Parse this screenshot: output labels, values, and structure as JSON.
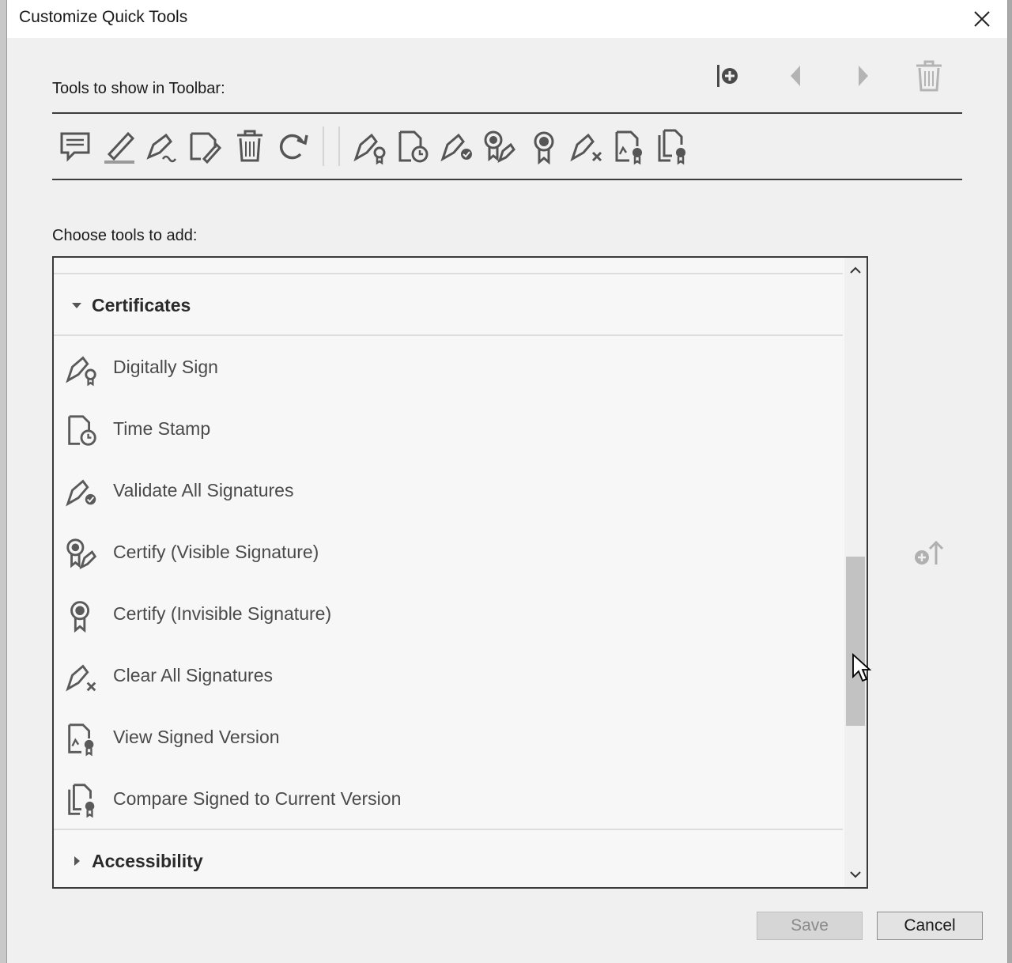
{
  "window": {
    "title": "Customize Quick Tools",
    "close_icon": "close-icon"
  },
  "toolbar_section": {
    "label": "Tools to show in Toolbar:",
    "actions": [
      {
        "name": "add-separator",
        "icon": "add-separator-icon"
      },
      {
        "name": "move-left",
        "icon": "triangle-left-icon"
      },
      {
        "name": "move-right",
        "icon": "triangle-right-icon"
      },
      {
        "name": "delete",
        "icon": "trash-icon"
      }
    ],
    "tools": [
      {
        "icon": "comment-icon"
      },
      {
        "icon": "highlight-pen-icon"
      },
      {
        "icon": "sign-pen-icon"
      },
      {
        "icon": "edit-tag-icon"
      },
      {
        "icon": "trash-icon"
      },
      {
        "icon": "redo-icon"
      },
      {
        "icon": "digitally-sign-icon"
      },
      {
        "icon": "time-stamp-icon"
      },
      {
        "icon": "validate-signatures-icon"
      },
      {
        "icon": "certify-visible-icon"
      },
      {
        "icon": "certify-invisible-icon"
      },
      {
        "icon": "clear-signatures-icon"
      },
      {
        "icon": "view-signed-version-icon"
      },
      {
        "icon": "compare-signed-icon"
      }
    ]
  },
  "choose_section": {
    "label": "Choose tools to add:",
    "categories": [
      {
        "label": "Certificates",
        "expanded": true,
        "items": [
          {
            "label": "Digitally Sign",
            "icon": "digitally-sign-icon"
          },
          {
            "label": "Time Stamp",
            "icon": "time-stamp-icon"
          },
          {
            "label": "Validate All Signatures",
            "icon": "validate-signatures-icon"
          },
          {
            "label": "Certify (Visible Signature)",
            "icon": "certify-visible-icon"
          },
          {
            "label": "Certify (Invisible Signature)",
            "icon": "certify-invisible-icon"
          },
          {
            "label": "Clear All Signatures",
            "icon": "clear-signatures-icon"
          },
          {
            "label": "View Signed Version",
            "icon": "view-signed-version-icon"
          },
          {
            "label": "Compare Signed to Current Version",
            "icon": "compare-signed-icon"
          }
        ]
      },
      {
        "label": "Accessibility",
        "expanded": false,
        "items": []
      }
    ],
    "add_to_toolbar_icon": "add-to-toolbar-icon"
  },
  "buttons": {
    "save": "Save",
    "cancel": "Cancel"
  },
  "colors": {
    "dialog_bg": "#f0f0f0",
    "list_bg": "#f7f7f7",
    "icon_gray": "#5a5a5a",
    "disabled_gray": "#b4b4b4"
  }
}
